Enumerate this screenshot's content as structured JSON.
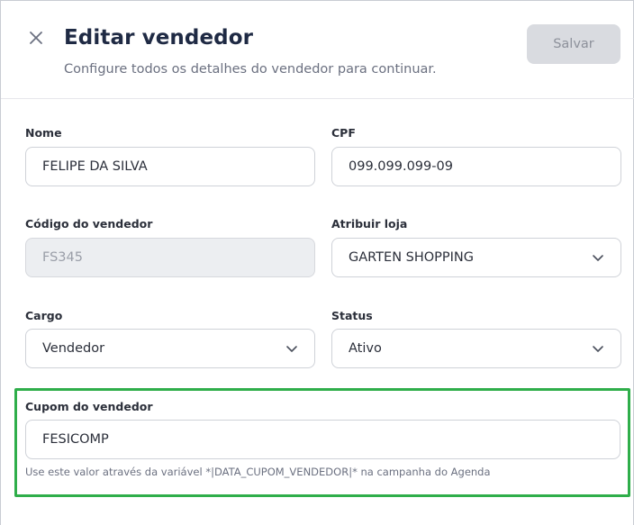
{
  "header": {
    "title": "Editar vendedor",
    "subtitle": "Configure todos os detalhes do vendedor para continuar.",
    "save_label": "Salvar"
  },
  "form": {
    "nome": {
      "label": "Nome",
      "value": "FELIPE DA SILVA"
    },
    "cpf": {
      "label": "CPF",
      "value": "099.099.099-09"
    },
    "codigo": {
      "label": "Código do vendedor",
      "value": "FS345"
    },
    "loja": {
      "label": "Atribuir loja",
      "value": "GARTEN SHOPPING"
    },
    "cargo": {
      "label": "Cargo",
      "value": "Vendedor"
    },
    "status": {
      "label": "Status",
      "value": "Ativo"
    },
    "cupom": {
      "label": "Cupom do vendedor",
      "value": "FESICOMP",
      "help": "Use este valor através da variável *|DATA_CUPOM_VENDEDOR|* na campanha do Agenda"
    }
  },
  "colors": {
    "highlight": "#2fae4a",
    "save_disabled_bg": "#d9dbe0",
    "title": "#1f2a44"
  },
  "icons": {
    "close": "close-icon",
    "chevron": "chevron-down-icon"
  }
}
